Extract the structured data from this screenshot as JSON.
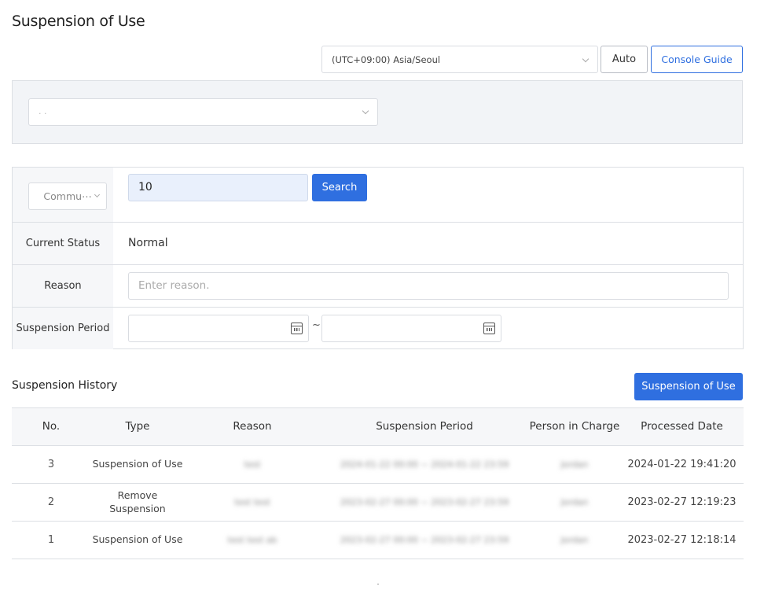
{
  "page": {
    "title": "Suspension of Use"
  },
  "toolbar": {
    "timezone": "(UTC+09:00) Asia/Seoul",
    "auto_label": "Auto",
    "guide_label": "Console Guide"
  },
  "filter": {
    "project_value": ". ."
  },
  "form": {
    "type_select": "Commu⋯",
    "id_value": "10",
    "search_label": "Search",
    "status_label": "Current Status",
    "status_value": "Normal",
    "reason_label": "Reason",
    "reason_placeholder": "Enter reason.",
    "period_label": "Suspension Period",
    "tilde": "~"
  },
  "history": {
    "title": "Suspension History",
    "action_label": "Suspension of Use",
    "columns": [
      "No.",
      "Type",
      "Reason",
      "Suspension Period",
      "Person in Charge",
      "Processed Date"
    ],
    "rows": [
      {
        "no": "3",
        "type": "Suspension of Use",
        "reason": "test",
        "period": "2024-01-22 00:00 ~ 2024-01-22 23:59",
        "person": "Jordan",
        "date": "2024-01-22 19:41:20"
      },
      {
        "no": "2",
        "type": "Remove Suspension",
        "reason": "test test",
        "period": "2023-02-27 00:00 ~ 2023-02-27 23:59",
        "person": "Jordan",
        "date": "2023-02-27 12:19:23"
      },
      {
        "no": "1",
        "type": "Suspension of Use",
        "reason": "test test ab",
        "period": "2023-02-27 00:00 ~ 2023-02-27 23:59",
        "person": "Jordan",
        "date": "2023-02-27 12:18:14"
      }
    ]
  },
  "colors": {
    "accent": "#2f6fe0",
    "label_bg": "#f6f7f9",
    "border": "#dcdfe4"
  }
}
